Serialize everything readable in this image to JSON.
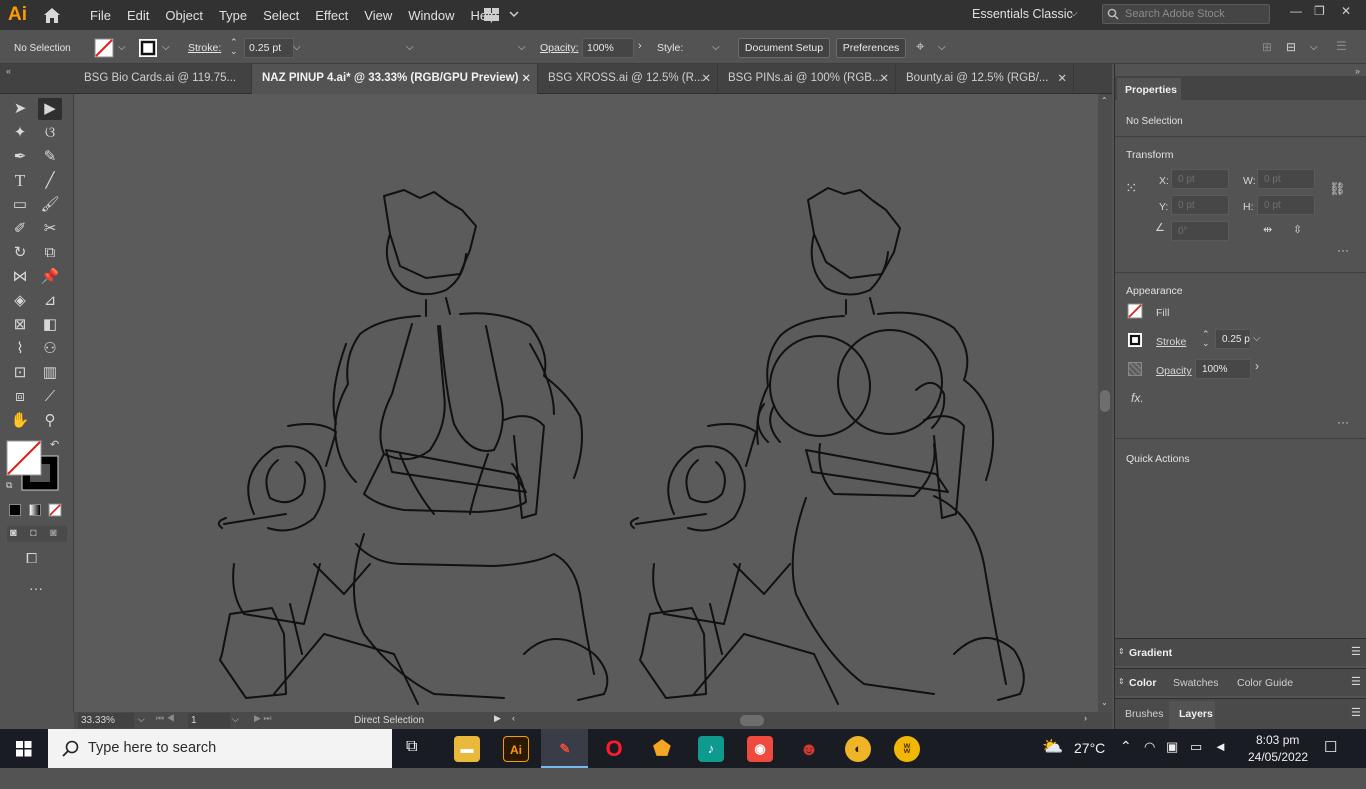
{
  "app": {
    "logo": "Ai"
  },
  "menu": [
    "File",
    "Edit",
    "Object",
    "Type",
    "Select",
    "Effect",
    "View",
    "Window",
    "Help"
  ],
  "workspace": "Essentials Classic",
  "stock_search": {
    "placeholder": "Search Adobe Stock"
  },
  "control": {
    "selection": "No Selection",
    "stroke_label": "Stroke:",
    "stroke_value": "0.25 pt",
    "opacity_label": "Opacity:",
    "opacity_value": "100%",
    "style_label": "Style:",
    "document_setup": "Document Setup",
    "preferences": "Preferences"
  },
  "tabs": [
    {
      "label": "BSG Bio Cards.ai @ 119.75..."
    },
    {
      "label": "NAZ PINUP 4.ai* @ 33.33% (RGB/GPU Preview)"
    },
    {
      "label": "BSG XROSS.ai @ 12.5% (R..."
    },
    {
      "label": "BSG PINs.ai @ 100% (RGB..."
    },
    {
      "label": "Bounty.ai @ 12.5% (RGB/..."
    }
  ],
  "status": {
    "zoom": "33.33%",
    "page": "1",
    "tool": "Direct Selection"
  },
  "properties": {
    "tab": "Properties",
    "selection": "No Selection",
    "transform": "Transform",
    "x_label": "X:",
    "x_value": "0 pt",
    "y_label": "Y:",
    "y_value": "0 pt",
    "w_label": "W:",
    "w_value": "0 pt",
    "h_label": "H:",
    "h_value": "0 pt",
    "angle_value": "0°",
    "appearance": "Appearance",
    "fill": "Fill",
    "stroke": "Stroke",
    "stroke_value": "0.25 p",
    "opacity": "Opacity",
    "opacity_value": "100%",
    "fx": "fx.",
    "quick_actions": "Quick Actions"
  },
  "panels": {
    "gradient": "Gradient",
    "color": "Color",
    "swatches": "Swatches",
    "color_guide": "Color Guide",
    "brushes": "Brushes",
    "layers": "Layers"
  },
  "taskbar": {
    "search_placeholder": "Type here to search",
    "weather": "27°C",
    "time": "8:03 pm",
    "date": "24/05/2022"
  },
  "colors": {
    "ai_orange": "#ff9a00",
    "ui_dark": "#323232",
    "ui_mid": "#535353"
  }
}
